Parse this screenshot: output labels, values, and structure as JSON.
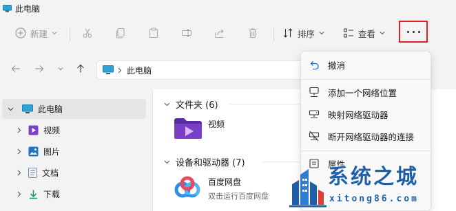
{
  "window": {
    "title": "此电脑"
  },
  "toolbar": {
    "new_label": "新建",
    "sort_label": "排序",
    "view_label": "查看",
    "more_label": "...",
    "highlight_color": "#e02020"
  },
  "address": {
    "path": "此电脑"
  },
  "sidebar": {
    "items": [
      {
        "label": "此电脑",
        "icon": "computer-icon"
      },
      {
        "label": "视频",
        "icon": "video-folder-icon"
      },
      {
        "label": "图片",
        "icon": "pictures-folder-icon"
      },
      {
        "label": "文档",
        "icon": "documents-folder-icon"
      },
      {
        "label": "下载",
        "icon": "download-folder-icon"
      }
    ]
  },
  "content": {
    "folders_header": "文件夹 (6)",
    "devices_header": "设备和驱动器 (7)",
    "folder_tile": {
      "label": "视频"
    },
    "device_tile": {
      "label": "百度网盘",
      "sublabel": "双击运行百度网盘"
    }
  },
  "menu": {
    "items": [
      {
        "label": "撤消",
        "icon": "undo-icon"
      },
      {
        "label": "添加一个网络位置",
        "icon": "network-location-icon"
      },
      {
        "label": "映射网络驱动器",
        "icon": "map-drive-icon"
      },
      {
        "label": "断开网络驱动器的连接",
        "icon": "disconnect-drive-icon"
      },
      {
        "label": "属性",
        "icon": "properties-icon"
      }
    ]
  },
  "watermark": {
    "title": "系统之城",
    "url": "xitong86.com"
  }
}
